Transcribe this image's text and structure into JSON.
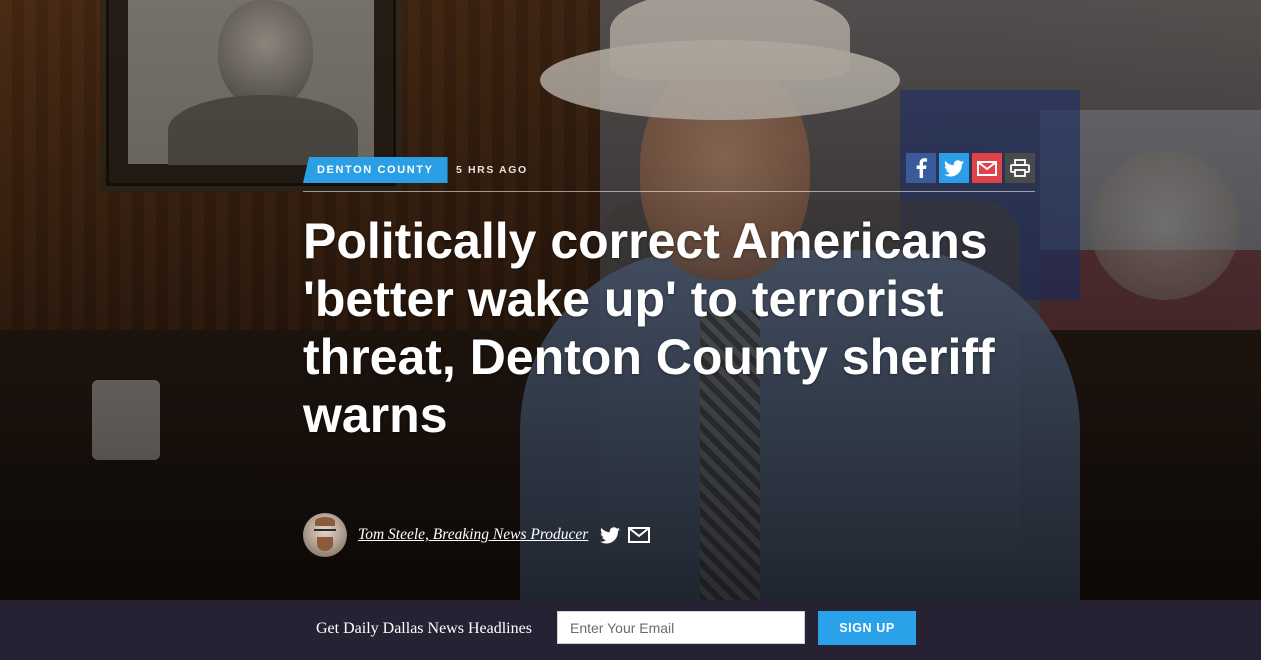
{
  "article": {
    "category": "DENTON COUNTY",
    "timestamp": "5 HRS AGO",
    "headline": "Politically correct Americans 'better wake up' to terrorist threat, Denton County sheriff warns",
    "author": "Tom Steele, Breaking News Producer"
  },
  "share": {
    "buttons": [
      {
        "name": "facebook-icon",
        "color": "#3b5a9a"
      },
      {
        "name": "twitter-icon",
        "color": "#2c9ee8"
      },
      {
        "name": "email-icon",
        "color": "#e0424a"
      },
      {
        "name": "print-icon",
        "color": "#4a4a4a"
      }
    ]
  },
  "author_icons": [
    "twitter-icon",
    "email-icon"
  ],
  "newsletter": {
    "label": "Get Daily Dallas News Headlines",
    "placeholder": "Enter Your Email",
    "button": "SIGN UP"
  },
  "colors": {
    "accent": "#2a9fe6",
    "newsletter_bar": "#262233"
  }
}
